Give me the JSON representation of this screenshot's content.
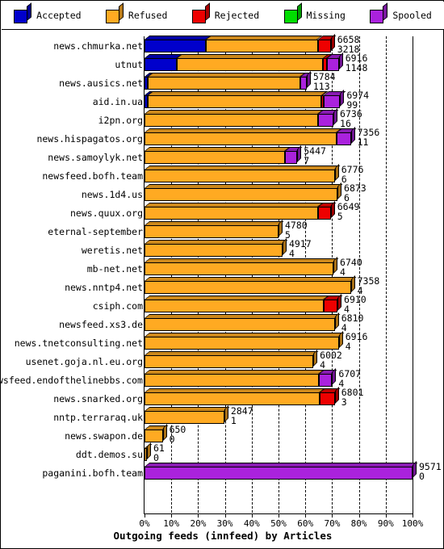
{
  "legend": {
    "items": [
      {
        "label": "Accepted",
        "color": "#0000CC"
      },
      {
        "label": "Refused",
        "color": "#FFAA22"
      },
      {
        "label": "Rejected",
        "color": "#EE0000"
      },
      {
        "label": "Missing",
        "color": "#00DD00"
      },
      {
        "label": "Spooled",
        "color": "#AA22DD"
      }
    ]
  },
  "axis": {
    "xlabel": "Outgoing feeds (innfeed) by Articles",
    "ticks": [
      "0%",
      "10%",
      "20%",
      "30%",
      "40%",
      "50%",
      "60%",
      "70%",
      "80%",
      "90%",
      "100%"
    ]
  },
  "chart_data": {
    "type": "bar",
    "orientation": "horizontal",
    "stacked": true,
    "normalized_percent": true,
    "title": "Outgoing feeds (innfeed) by Articles",
    "xlabel": "Outgoing feeds (innfeed) by Articles",
    "ylabel": "",
    "xlim": [
      0,
      100
    ],
    "xticks": [
      0,
      10,
      20,
      30,
      40,
      50,
      60,
      70,
      80,
      90,
      100
    ],
    "xticklabels": [
      "0%",
      "10%",
      "20%",
      "30%",
      "40%",
      "50%",
      "60%",
      "70%",
      "80%",
      "90%",
      "100%"
    ],
    "grid": true,
    "legend_position": "top",
    "series": [
      {
        "name": "Accepted",
        "color": "#0000CC"
      },
      {
        "name": "Refused",
        "color": "#FFAA22"
      },
      {
        "name": "Rejected",
        "color": "#EE0000"
      },
      {
        "name": "Missing",
        "color": "#00DD00"
      },
      {
        "name": "Spooled",
        "color": "#AA22DD"
      }
    ],
    "categories": [
      "news.chmurka.net",
      "utnut",
      "news.ausics.net",
      "aid.in.ua",
      "i2pn.org",
      "news.hispagatos.org",
      "news.samoylyk.net",
      "newsfeed.bofh.team",
      "news.1d4.us",
      "news.quux.org",
      "eternal-september",
      "weretis.net",
      "mb-net.net",
      "news.nntp4.net",
      "csiph.com",
      "newsfeed.xs3.de",
      "news.tnetconsulting.net",
      "usenet.goja.nl.eu.org",
      "newsfeed.endofthelinebbs.com",
      "news.snarked.org",
      "nntp.terraraq.uk",
      "news.swapon.de",
      "ddt.demos.su",
      "paganini.bofh.team"
    ],
    "bars": [
      {
        "label": "news.chmurka.net",
        "total": 6658,
        "second": 3218,
        "bar_pct": 69.5,
        "segments": [
          {
            "name": "Accepted",
            "pct": 33.0
          },
          {
            "name": "Refused",
            "pct": 60.0
          },
          {
            "name": "Rejected",
            "pct": 7.0
          }
        ]
      },
      {
        "label": "utnut",
        "total": 6916,
        "second": 1148,
        "bar_pct": 72.5,
        "segments": [
          {
            "name": "Accepted",
            "pct": 16.5
          },
          {
            "name": "Refused",
            "pct": 75.5
          },
          {
            "name": "Rejected",
            "pct": 2.0
          },
          {
            "name": "Spooled",
            "pct": 6.0
          }
        ]
      },
      {
        "label": "news.ausics.net",
        "total": 5784,
        "second": 113,
        "bar_pct": 60.5,
        "segments": [
          {
            "name": "Accepted",
            "pct": 2.0
          },
          {
            "name": "Refused",
            "pct": 94.0
          },
          {
            "name": "Spooled",
            "pct": 4.0
          }
        ]
      },
      {
        "label": "aid.in.ua",
        "total": 6974,
        "second": 99,
        "bar_pct": 73.0,
        "segments": [
          {
            "name": "Accepted",
            "pct": 1.5
          },
          {
            "name": "Refused",
            "pct": 89.0
          },
          {
            "name": "Rejected",
            "pct": 1.0
          },
          {
            "name": "Spooled",
            "pct": 8.5
          }
        ]
      },
      {
        "label": "i2pn.org",
        "total": 6736,
        "second": 16,
        "bar_pct": 70.5,
        "segments": [
          {
            "name": "Refused",
            "pct": 92.0
          },
          {
            "name": "Spooled",
            "pct": 8.0
          }
        ]
      },
      {
        "label": "news.hispagatos.org",
        "total": 7356,
        "second": 11,
        "bar_pct": 77.0,
        "segments": [
          {
            "name": "Refused",
            "pct": 93.0
          },
          {
            "name": "Spooled",
            "pct": 7.0
          }
        ]
      },
      {
        "label": "news.samoylyk.net",
        "total": 5447,
        "second": 7,
        "bar_pct": 57.0,
        "segments": [
          {
            "name": "Refused",
            "pct": 92.0
          },
          {
            "name": "Spooled",
            "pct": 8.0
          }
        ]
      },
      {
        "label": "newsfeed.bofh.team",
        "total": 6776,
        "second": 6,
        "bar_pct": 71.0,
        "segments": [
          {
            "name": "Refused",
            "pct": 100.0
          }
        ]
      },
      {
        "label": "news.1d4.us",
        "total": 6873,
        "second": 6,
        "bar_pct": 72.0,
        "segments": [
          {
            "name": "Refused",
            "pct": 100.0
          }
        ]
      },
      {
        "label": "news.quux.org",
        "total": 6649,
        "second": 5,
        "bar_pct": 69.5,
        "segments": [
          {
            "name": "Refused",
            "pct": 93.0
          },
          {
            "name": "Rejected",
            "pct": 7.0
          }
        ]
      },
      {
        "label": "eternal-september",
        "total": 4780,
        "second": 5,
        "bar_pct": 50.0,
        "segments": [
          {
            "name": "Refused",
            "pct": 100.0
          }
        ]
      },
      {
        "label": "weretis.net",
        "total": 4917,
        "second": 4,
        "bar_pct": 51.5,
        "segments": [
          {
            "name": "Refused",
            "pct": 100.0
          }
        ]
      },
      {
        "label": "mb-net.net",
        "total": 6740,
        "second": 4,
        "bar_pct": 70.5,
        "segments": [
          {
            "name": "Refused",
            "pct": 100.0
          }
        ]
      },
      {
        "label": "news.nntp4.net",
        "total": 7358,
        "second": 4,
        "bar_pct": 77.0,
        "segments": [
          {
            "name": "Refused",
            "pct": 100.0
          }
        ]
      },
      {
        "label": "csiph.com",
        "total": 6910,
        "second": 4,
        "bar_pct": 72.0,
        "segments": [
          {
            "name": "Refused",
            "pct": 93.0
          },
          {
            "name": "Rejected",
            "pct": 7.0
          }
        ]
      },
      {
        "label": "newsfeed.xs3.de",
        "total": 6810,
        "second": 4,
        "bar_pct": 71.0,
        "segments": [
          {
            "name": "Refused",
            "pct": 100.0
          }
        ]
      },
      {
        "label": "news.tnetconsulting.net",
        "total": 6916,
        "second": 4,
        "bar_pct": 72.5,
        "segments": [
          {
            "name": "Refused",
            "pct": 100.0
          }
        ]
      },
      {
        "label": "usenet.goja.nl.eu.org",
        "total": 6002,
        "second": 4,
        "bar_pct": 63.0,
        "segments": [
          {
            "name": "Refused",
            "pct": 100.0
          }
        ]
      },
      {
        "label": "newsfeed.endofthelinebbs.com",
        "total": 6707,
        "second": 4,
        "bar_pct": 70.0,
        "segments": [
          {
            "name": "Refused",
            "pct": 93.0
          },
          {
            "name": "Spooled",
            "pct": 7.0
          }
        ]
      },
      {
        "label": "news.snarked.org",
        "total": 6801,
        "second": 3,
        "bar_pct": 71.0,
        "segments": [
          {
            "name": "Refused",
            "pct": 92.0
          },
          {
            "name": "Rejected",
            "pct": 8.0
          }
        ]
      },
      {
        "label": "nntp.terraraq.uk",
        "total": 2847,
        "second": 1,
        "bar_pct": 29.8,
        "segments": [
          {
            "name": "Refused",
            "pct": 100.0
          }
        ]
      },
      {
        "label": "news.swapon.de",
        "total": 650,
        "second": 0,
        "bar_pct": 6.8,
        "segments": [
          {
            "name": "Refused",
            "pct": 100.0
          }
        ]
      },
      {
        "label": "ddt.demos.su",
        "total": 61,
        "second": 0,
        "bar_pct": 0.7,
        "segments": [
          {
            "name": "Refused",
            "pct": 100.0
          }
        ]
      },
      {
        "label": "paganini.bofh.team",
        "total": 9571,
        "second": 0,
        "bar_pct": 100.0,
        "segments": [
          {
            "name": "Spooled",
            "pct": 100.0
          }
        ]
      }
    ]
  }
}
